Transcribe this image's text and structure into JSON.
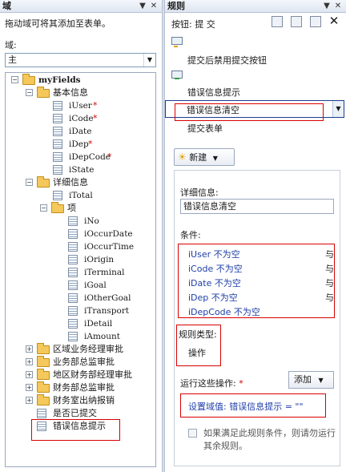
{
  "left": {
    "title": "域",
    "hint": "拖动域可将其添加至表单。",
    "domain_label": "域:",
    "selected_domain": "主",
    "tree": {
      "root": "myFields",
      "group1": "基本信息",
      "fields1": [
        "iUser",
        "iCode",
        "iDate",
        "iDep",
        "iDepCode",
        "iState"
      ],
      "group2": "详细信息",
      "total": "iTotal",
      "item_group": "项",
      "items": [
        "iNo",
        "iOccurDate",
        "iOccurTime",
        "iOrigin",
        "iTerminal",
        "iGoal",
        "iOtherGoal",
        "iTransport",
        "iDetail",
        "iAmount"
      ],
      "approvals": [
        "区域业务经理审批",
        "业务部总监审批",
        "地区财务部经理审批",
        "财务部总监审批",
        "财务室出纳报销"
      ],
      "submitted": "是否已提交",
      "error_hint": "错误信息提示"
    }
  },
  "right": {
    "title": "规则",
    "button_label": "按钮: 提 交",
    "rules": [
      "提交后禁用提交按钮",
      "错误信息提示",
      "错误信息清空",
      "提交表单"
    ],
    "new_button": "新建",
    "details_label": "详细信息:",
    "details_value": "错误信息清空",
    "conditions_label": "条件:",
    "conditions": [
      "iUser 不为空",
      "iCode 不为空",
      "iDate 不为空",
      "iDep 不为空",
      "iDepCode 不为空"
    ],
    "and_word": "与",
    "rule_type_label": "规则类型:",
    "rule_type_value": "操作",
    "run_label": "运行这些操作:",
    "required_mark": "*",
    "add_button": "添加",
    "action": "设置域值: 错误信息提示 = \"\"",
    "stop_text": "如果满足此规则条件，则请勿运行其余规则。"
  },
  "colors": {
    "highlight_red": "#d80000",
    "link_blue": "#1f3ea8",
    "selection_border": "#1c3d8e"
  }
}
